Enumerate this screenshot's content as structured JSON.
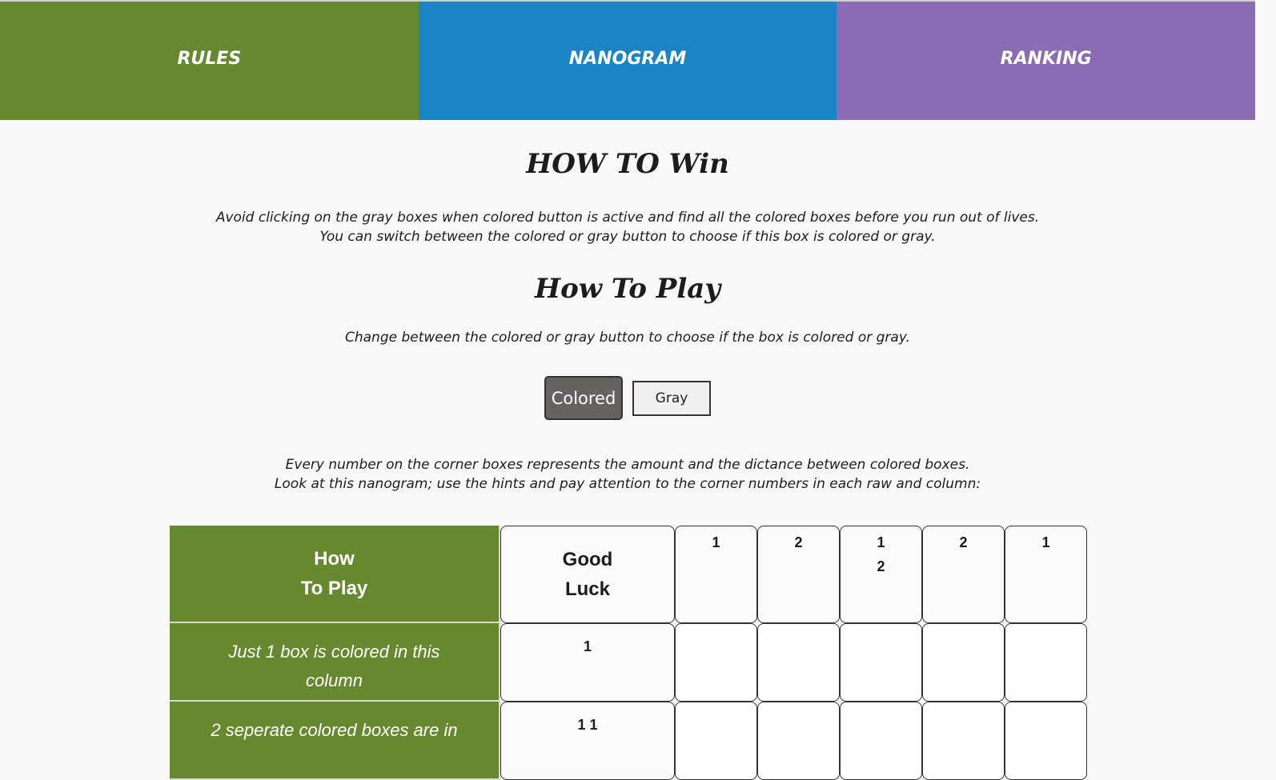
{
  "nav": {
    "tabs": [
      {
        "label": "RULES",
        "color": "#66882e"
      },
      {
        "label": "NANOGRAM",
        "color": "#1b84c6"
      },
      {
        "label": "RANKING",
        "color": "#8a6bb4"
      }
    ]
  },
  "how_to_win": {
    "title": "HOW TO Win",
    "line1": "Avoid clicking on the gray boxes when colored button is active and find all the colored boxes before you run out of lives.",
    "line2": "You can switch between the colored or gray button to choose if this box is colored or gray."
  },
  "how_to_play": {
    "title": "How To Play",
    "instruction": "Change between the colored or gray button to choose if the box is colored or gray.",
    "colored_button": "Colored",
    "gray_button": "Gray",
    "line1": "Every number on the corner boxes represents the amount and the dictance between colored boxes.",
    "line2": "Look at this nanogram; use the hints and pay attention to the corner numbers in each raw and column:"
  },
  "example": {
    "corner_title": {
      "line1": "How",
      "line2": "To Play"
    },
    "good_luck": {
      "line1": "Good",
      "line2": "Luck"
    },
    "column_hints": [
      {
        "line1": "1",
        "line2": ""
      },
      {
        "line1": "2",
        "line2": ""
      },
      {
        "line1": "1",
        "line2": "2"
      },
      {
        "line1": "2",
        "line2": ""
      },
      {
        "line1": "1",
        "line2": ""
      }
    ],
    "rows": [
      {
        "hint_text": "Just 1 box is colored in this column",
        "numbers": "1"
      },
      {
        "hint_text": "2 seperate colored boxes are in",
        "numbers": "1 1"
      }
    ]
  }
}
